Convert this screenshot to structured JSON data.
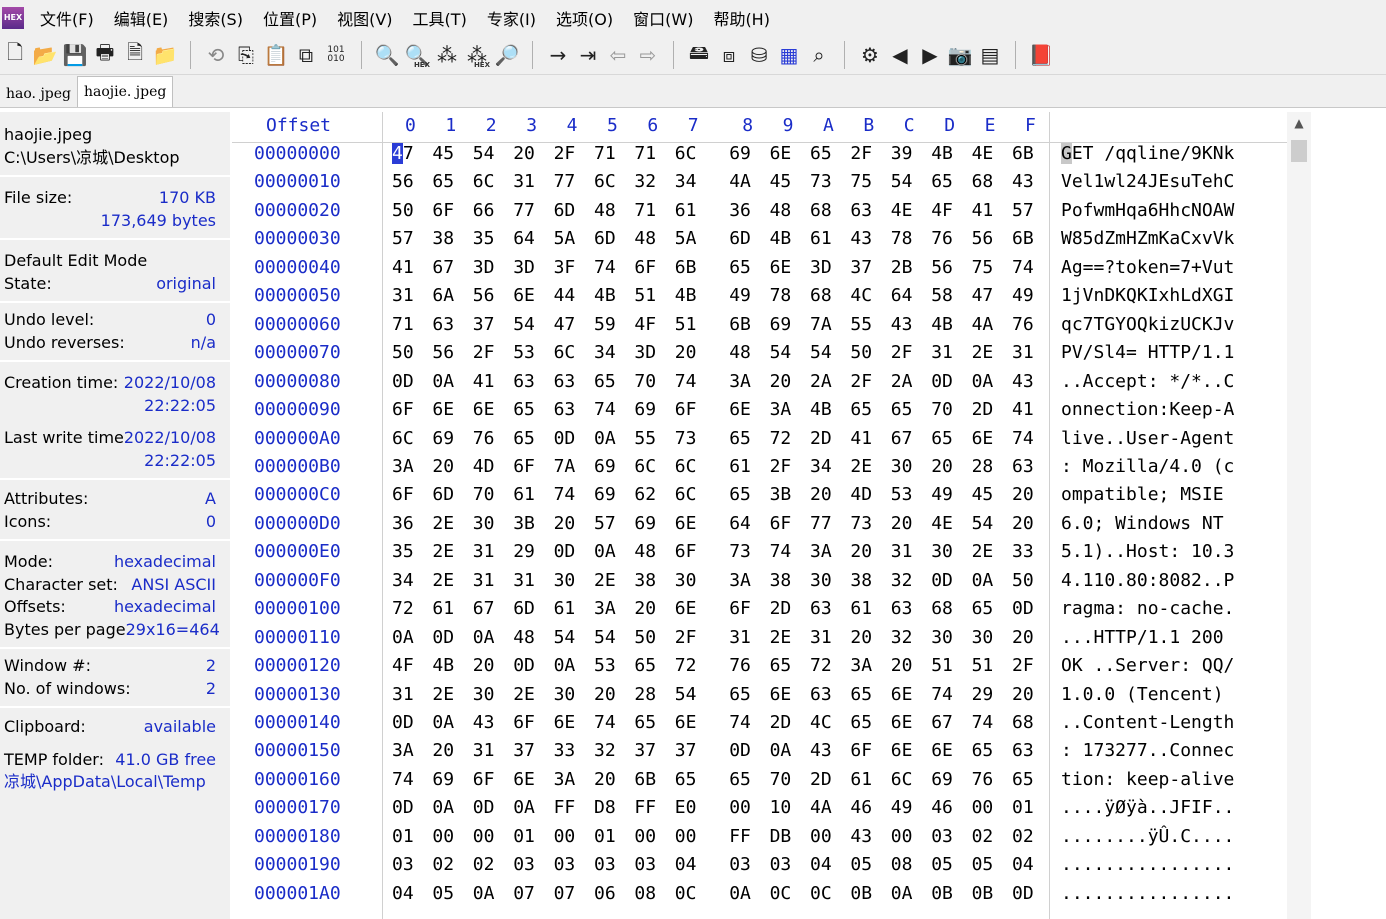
{
  "app_icon_text": "HEX",
  "menu": [
    "文件(F)",
    "编辑(E)",
    "搜索(S)",
    "位置(P)",
    "视图(V)",
    "工具(T)",
    "专家(I)",
    "选项(O)",
    "窗口(W)",
    "帮助(H)"
  ],
  "toolbar_sub": {
    "hex1": "HEX",
    "hex2": "HEX",
    "bin": "101\n010"
  },
  "tabs": [
    "hao. jpeg",
    "haojie. jpeg"
  ],
  "info": {
    "filename": "haojie.jpeg",
    "path": "C:\\Users\\凉城\\Desktop",
    "file_size_label": "File size:",
    "file_size_kb": "170 KB",
    "file_size_bytes": "173,649 bytes",
    "edit_mode_label": "Default Edit Mode",
    "state_label": "State:",
    "state_value": "original",
    "undo_level_label": "Undo level:",
    "undo_level_value": "0",
    "undo_reverses_label": "Undo reverses:",
    "undo_reverses_value": "n/a",
    "creation_label": "Creation time:",
    "creation_date": "2022/10/08",
    "creation_time": "22:22:05",
    "lastwrite_label": "Last write time",
    "lastwrite_date": "2022/10/08",
    "lastwrite_time": "22:22:05",
    "attributes_label": "Attributes:",
    "attributes_value": "A",
    "icons_label": "Icons:",
    "icons_value": "0",
    "mode_label": "Mode:",
    "mode_value": "hexadecimal",
    "charset_label": "Character set:",
    "charset_value": "ANSI ASCII",
    "offsets_label": "Offsets:",
    "offsets_value": "hexadecimal",
    "bpp_label": "Bytes per page",
    "bpp_value": "29x16=464",
    "window_label": "Window #:",
    "window_value": "2",
    "nwin_label": "No. of windows:",
    "nwin_value": "2",
    "clipboard_label": "Clipboard:",
    "clipboard_value": "available",
    "temp_label": "TEMP folder:",
    "temp_free": "41.0 GB free",
    "temp_path": "凉城\\AppData\\Local\\Temp"
  },
  "header": {
    "offset_label": "Offset",
    "columns": [
      "0",
      "1",
      "2",
      "3",
      "4",
      "5",
      "6",
      "7",
      "8",
      "9",
      "A",
      "B",
      "C",
      "D",
      "E",
      "F"
    ]
  },
  "rows": [
    {
      "offset": "00000000",
      "bytes": [
        "47",
        "45",
        "54",
        "20",
        "2F",
        "71",
        "71",
        "6C",
        "69",
        "6E",
        "65",
        "2F",
        "39",
        "4B",
        "4E",
        "6B"
      ],
      "text": "GET /qqline/9KNk"
    },
    {
      "offset": "00000010",
      "bytes": [
        "56",
        "65",
        "6C",
        "31",
        "77",
        "6C",
        "32",
        "34",
        "4A",
        "45",
        "73",
        "75",
        "54",
        "65",
        "68",
        "43"
      ],
      "text": "Vel1wl24JEsuTehC"
    },
    {
      "offset": "00000020",
      "bytes": [
        "50",
        "6F",
        "66",
        "77",
        "6D",
        "48",
        "71",
        "61",
        "36",
        "48",
        "68",
        "63",
        "4E",
        "4F",
        "41",
        "57"
      ],
      "text": "PofwmHqa6HhcNOAW"
    },
    {
      "offset": "00000030",
      "bytes": [
        "57",
        "38",
        "35",
        "64",
        "5A",
        "6D",
        "48",
        "5A",
        "6D",
        "4B",
        "61",
        "43",
        "78",
        "76",
        "56",
        "6B"
      ],
      "text": "W85dZmHZmKaCxvVk"
    },
    {
      "offset": "00000040",
      "bytes": [
        "41",
        "67",
        "3D",
        "3D",
        "3F",
        "74",
        "6F",
        "6B",
        "65",
        "6E",
        "3D",
        "37",
        "2B",
        "56",
        "75",
        "74"
      ],
      "text": "Ag==?token=7+Vut"
    },
    {
      "offset": "00000050",
      "bytes": [
        "31",
        "6A",
        "56",
        "6E",
        "44",
        "4B",
        "51",
        "4B",
        "49",
        "78",
        "68",
        "4C",
        "64",
        "58",
        "47",
        "49"
      ],
      "text": "1jVnDKQKIxhLdXGI"
    },
    {
      "offset": "00000060",
      "bytes": [
        "71",
        "63",
        "37",
        "54",
        "47",
        "59",
        "4F",
        "51",
        "6B",
        "69",
        "7A",
        "55",
        "43",
        "4B",
        "4A",
        "76"
      ],
      "text": "qc7TGYOQkizUCKJv"
    },
    {
      "offset": "00000070",
      "bytes": [
        "50",
        "56",
        "2F",
        "53",
        "6C",
        "34",
        "3D",
        "20",
        "48",
        "54",
        "54",
        "50",
        "2F",
        "31",
        "2E",
        "31"
      ],
      "text": "PV/Sl4= HTTP/1.1"
    },
    {
      "offset": "00000080",
      "bytes": [
        "0D",
        "0A",
        "41",
        "63",
        "63",
        "65",
        "70",
        "74",
        "3A",
        "20",
        "2A",
        "2F",
        "2A",
        "0D",
        "0A",
        "43"
      ],
      "text": "..Accept: */*..C"
    },
    {
      "offset": "00000090",
      "bytes": [
        "6F",
        "6E",
        "6E",
        "65",
        "63",
        "74",
        "69",
        "6F",
        "6E",
        "3A",
        "4B",
        "65",
        "65",
        "70",
        "2D",
        "41"
      ],
      "text": "onnection:Keep-A"
    },
    {
      "offset": "000000A0",
      "bytes": [
        "6C",
        "69",
        "76",
        "65",
        "0D",
        "0A",
        "55",
        "73",
        "65",
        "72",
        "2D",
        "41",
        "67",
        "65",
        "6E",
        "74"
      ],
      "text": "live..User-Agent"
    },
    {
      "offset": "000000B0",
      "bytes": [
        "3A",
        "20",
        "4D",
        "6F",
        "7A",
        "69",
        "6C",
        "6C",
        "61",
        "2F",
        "34",
        "2E",
        "30",
        "20",
        "28",
        "63"
      ],
      "text": ": Mozilla/4.0 (c"
    },
    {
      "offset": "000000C0",
      "bytes": [
        "6F",
        "6D",
        "70",
        "61",
        "74",
        "69",
        "62",
        "6C",
        "65",
        "3B",
        "20",
        "4D",
        "53",
        "49",
        "45",
        "20"
      ],
      "text": "ompatible; MSIE "
    },
    {
      "offset": "000000D0",
      "bytes": [
        "36",
        "2E",
        "30",
        "3B",
        "20",
        "57",
        "69",
        "6E",
        "64",
        "6F",
        "77",
        "73",
        "20",
        "4E",
        "54",
        "20"
      ],
      "text": "6.0; Windows NT "
    },
    {
      "offset": "000000E0",
      "bytes": [
        "35",
        "2E",
        "31",
        "29",
        "0D",
        "0A",
        "48",
        "6F",
        "73",
        "74",
        "3A",
        "20",
        "31",
        "30",
        "2E",
        "33"
      ],
      "text": "5.1)..Host: 10.3"
    },
    {
      "offset": "000000F0",
      "bytes": [
        "34",
        "2E",
        "31",
        "31",
        "30",
        "2E",
        "38",
        "30",
        "3A",
        "38",
        "30",
        "38",
        "32",
        "0D",
        "0A",
        "50"
      ],
      "text": "4.110.80:8082..P"
    },
    {
      "offset": "00000100",
      "bytes": [
        "72",
        "61",
        "67",
        "6D",
        "61",
        "3A",
        "20",
        "6E",
        "6F",
        "2D",
        "63",
        "61",
        "63",
        "68",
        "65",
        "0D"
      ],
      "text": "ragma: no-cache."
    },
    {
      "offset": "00000110",
      "bytes": [
        "0A",
        "0D",
        "0A",
        "48",
        "54",
        "54",
        "50",
        "2F",
        "31",
        "2E",
        "31",
        "20",
        "32",
        "30",
        "30",
        "20"
      ],
      "text": "...HTTP/1.1 200 "
    },
    {
      "offset": "00000120",
      "bytes": [
        "4F",
        "4B",
        "20",
        "0D",
        "0A",
        "53",
        "65",
        "72",
        "76",
        "65",
        "72",
        "3A",
        "20",
        "51",
        "51",
        "2F"
      ],
      "text": "OK ..Server: QQ/"
    },
    {
      "offset": "00000130",
      "bytes": [
        "31",
        "2E",
        "30",
        "2E",
        "30",
        "20",
        "28",
        "54",
        "65",
        "6E",
        "63",
        "65",
        "6E",
        "74",
        "29",
        "20"
      ],
      "text": "1.0.0 (Tencent) "
    },
    {
      "offset": "00000140",
      "bytes": [
        "0D",
        "0A",
        "43",
        "6F",
        "6E",
        "74",
        "65",
        "6E",
        "74",
        "2D",
        "4C",
        "65",
        "6E",
        "67",
        "74",
        "68"
      ],
      "text": "..Content-Length"
    },
    {
      "offset": "00000150",
      "bytes": [
        "3A",
        "20",
        "31",
        "37",
        "33",
        "32",
        "37",
        "37",
        "0D",
        "0A",
        "43",
        "6F",
        "6E",
        "6E",
        "65",
        "63"
      ],
      "text": ": 173277..Connec"
    },
    {
      "offset": "00000160",
      "bytes": [
        "74",
        "69",
        "6F",
        "6E",
        "3A",
        "20",
        "6B",
        "65",
        "65",
        "70",
        "2D",
        "61",
        "6C",
        "69",
        "76",
        "65"
      ],
      "text": "tion: keep-alive"
    },
    {
      "offset": "00000170",
      "bytes": [
        "0D",
        "0A",
        "0D",
        "0A",
        "FF",
        "D8",
        "FF",
        "E0",
        "00",
        "10",
        "4A",
        "46",
        "49",
        "46",
        "00",
        "01"
      ],
      "text": "....ÿØÿà..JFIF.."
    },
    {
      "offset": "00000180",
      "bytes": [
        "01",
        "00",
        "00",
        "01",
        "00",
        "01",
        "00",
        "00",
        "FF",
        "DB",
        "00",
        "43",
        "00",
        "03",
        "02",
        "02"
      ],
      "text": "........ÿÛ.C...."
    },
    {
      "offset": "00000190",
      "bytes": [
        "03",
        "02",
        "02",
        "03",
        "03",
        "03",
        "03",
        "04",
        "03",
        "03",
        "04",
        "05",
        "08",
        "05",
        "05",
        "04"
      ],
      "text": "................"
    },
    {
      "offset": "000001A0",
      "bytes": [
        "04",
        "05",
        "0A",
        "07",
        "07",
        "06",
        "08",
        "0C",
        "0A",
        "0C",
        "0C",
        "0B",
        "0A",
        "0B",
        "0B",
        "0D"
      ],
      "text": "................"
    }
  ]
}
